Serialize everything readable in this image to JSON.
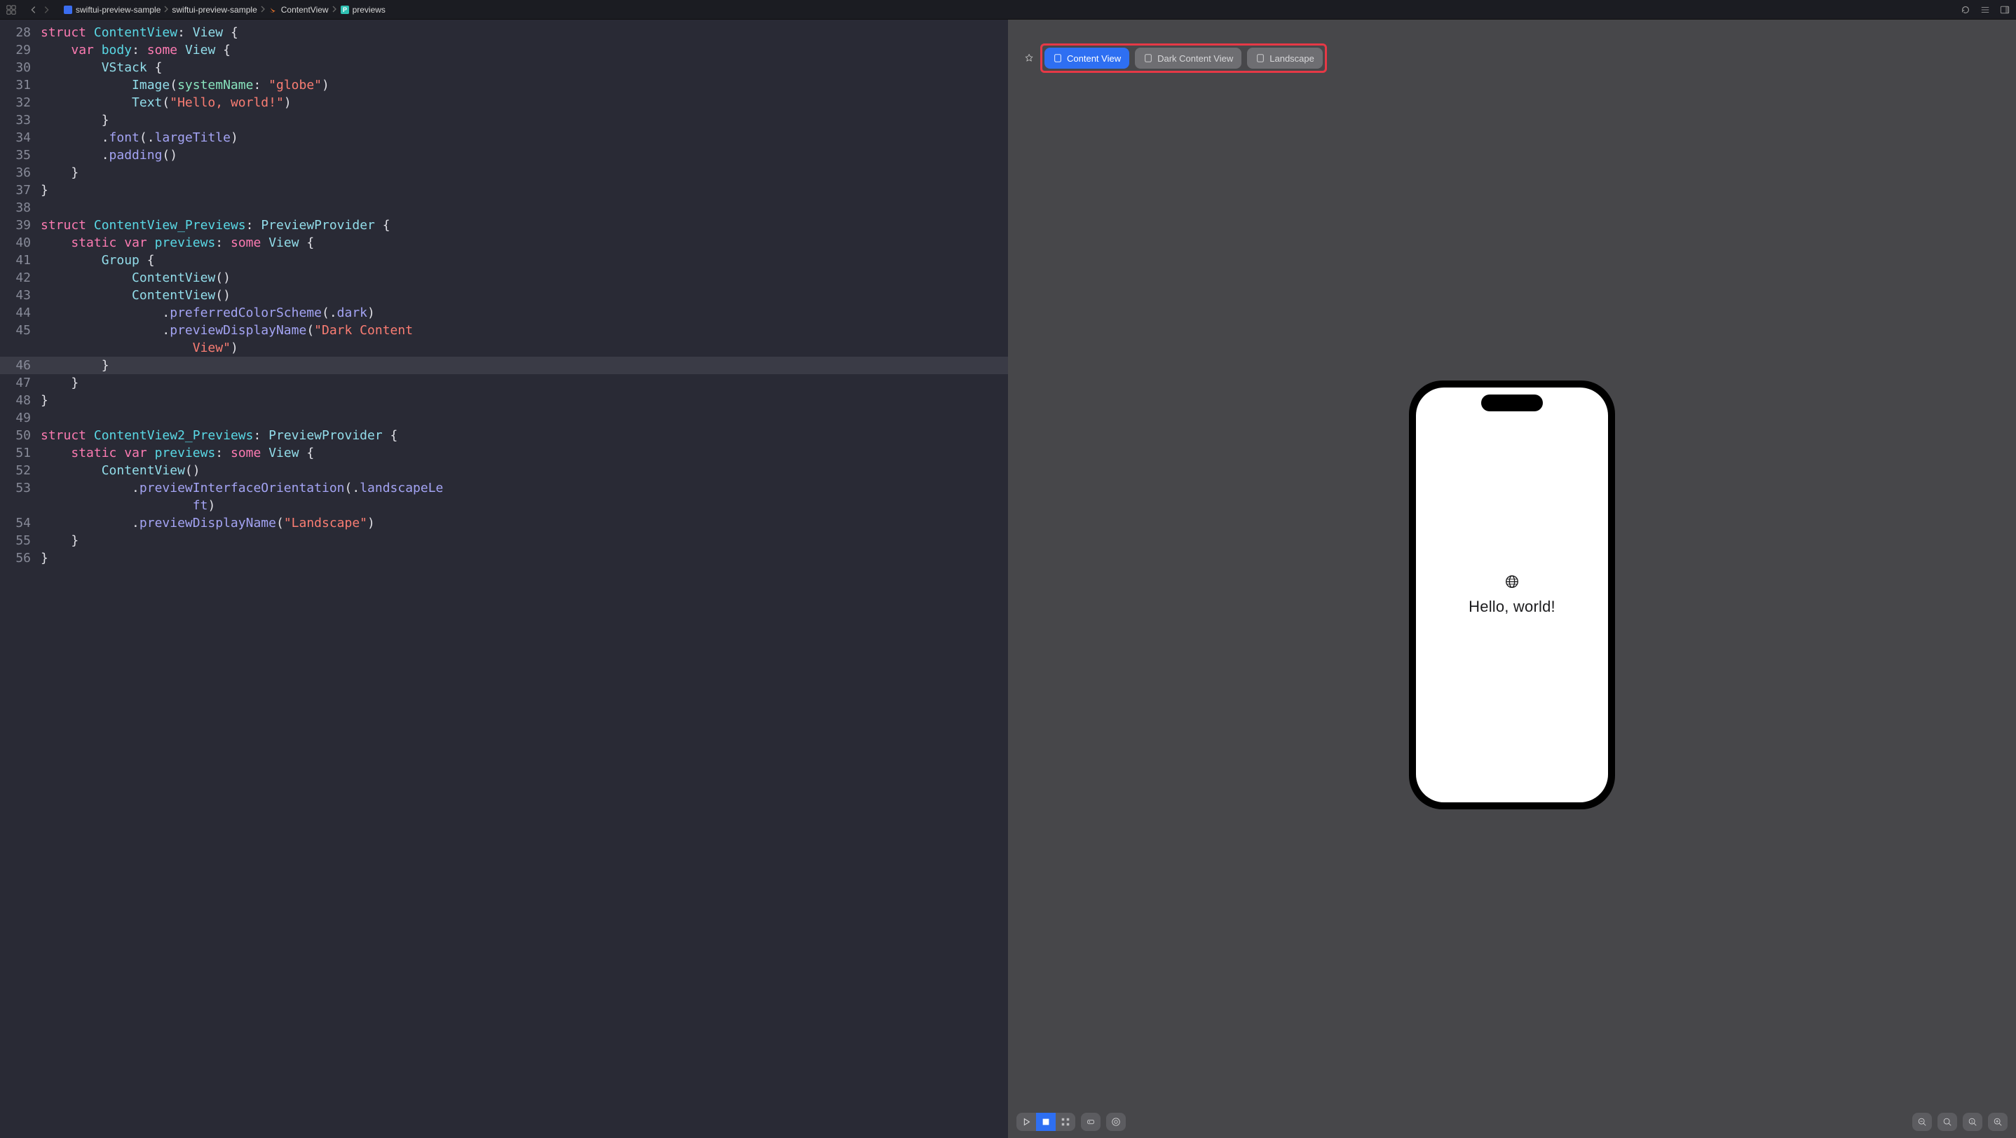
{
  "breadcrumb": {
    "items": [
      {
        "label": "swiftui-preview-sample",
        "icon": "proj"
      },
      {
        "label": "swiftui-preview-sample",
        "icon": "none"
      },
      {
        "label": "ContentView",
        "icon": "swift"
      },
      {
        "label": "previews",
        "icon": "p"
      }
    ]
  },
  "editor": {
    "startLine": 28,
    "cursorLine": 46,
    "lines": [
      [
        [
          "kw",
          "struct"
        ],
        [
          "plain",
          " "
        ],
        [
          "typeDecl",
          "ContentView"
        ],
        [
          "plain",
          ": "
        ],
        [
          "type",
          "View"
        ],
        [
          "plain",
          " {"
        ]
      ],
      [
        [
          "plain",
          "    "
        ],
        [
          "kw",
          "var"
        ],
        [
          "plain",
          " "
        ],
        [
          "typeDecl",
          "body"
        ],
        [
          "plain",
          ": "
        ],
        [
          "kw",
          "some"
        ],
        [
          "plain",
          " "
        ],
        [
          "type",
          "View"
        ],
        [
          "plain",
          " {"
        ]
      ],
      [
        [
          "plain",
          "        "
        ],
        [
          "type",
          "VStack"
        ],
        [
          "plain",
          " {"
        ]
      ],
      [
        [
          "plain",
          "            "
        ],
        [
          "type",
          "Image"
        ],
        [
          "plain",
          "("
        ],
        [
          "param",
          "systemName"
        ],
        [
          "plain",
          ": "
        ],
        [
          "string",
          "\"globe\""
        ],
        [
          "plain",
          ")"
        ]
      ],
      [
        [
          "plain",
          "            "
        ],
        [
          "type",
          "Text"
        ],
        [
          "plain",
          "("
        ],
        [
          "string",
          "\"Hello, world!\""
        ],
        [
          "plain",
          ")"
        ]
      ],
      [
        [
          "plain",
          "        }"
        ]
      ],
      [
        [
          "plain",
          "        ."
        ],
        [
          "func",
          "font"
        ],
        [
          "plain",
          "(."
        ],
        [
          "member",
          "largeTitle"
        ],
        [
          "plain",
          ")"
        ]
      ],
      [
        [
          "plain",
          "        ."
        ],
        [
          "func",
          "padding"
        ],
        [
          "plain",
          "()"
        ]
      ],
      [
        [
          "plain",
          "    }"
        ]
      ],
      [
        [
          "plain",
          "}"
        ]
      ],
      [
        [
          "plain",
          ""
        ]
      ],
      [
        [
          "kw",
          "struct"
        ],
        [
          "plain",
          " "
        ],
        [
          "typeDecl",
          "ContentView_Previews"
        ],
        [
          "plain",
          ": "
        ],
        [
          "type",
          "PreviewProvider"
        ],
        [
          "plain",
          " {"
        ]
      ],
      [
        [
          "plain",
          "    "
        ],
        [
          "kw",
          "static"
        ],
        [
          "plain",
          " "
        ],
        [
          "kw",
          "var"
        ],
        [
          "plain",
          " "
        ],
        [
          "typeDecl",
          "previews"
        ],
        [
          "plain",
          ": "
        ],
        [
          "kw",
          "some"
        ],
        [
          "plain",
          " "
        ],
        [
          "type",
          "View"
        ],
        [
          "plain",
          " {"
        ]
      ],
      [
        [
          "plain",
          "        "
        ],
        [
          "type",
          "Group"
        ],
        [
          "plain",
          " {"
        ]
      ],
      [
        [
          "plain",
          "            "
        ],
        [
          "type",
          "ContentView"
        ],
        [
          "plain",
          "()"
        ]
      ],
      [
        [
          "plain",
          "            "
        ],
        [
          "type",
          "ContentView"
        ],
        [
          "plain",
          "()"
        ]
      ],
      [
        [
          "plain",
          "                ."
        ],
        [
          "func",
          "preferredColorScheme"
        ],
        [
          "plain",
          "(."
        ],
        [
          "member",
          "dark"
        ],
        [
          "plain",
          ")"
        ]
      ],
      [
        [
          "plain",
          "                ."
        ],
        [
          "func",
          "previewDisplayName"
        ],
        [
          "plain",
          "("
        ],
        [
          "string",
          "\"Dark Content View\""
        ],
        [
          "plain",
          ")"
        ]
      ],
      [
        [
          "plain",
          "        }"
        ]
      ],
      [
        [
          "plain",
          "    }"
        ]
      ],
      [
        [
          "plain",
          "}"
        ]
      ],
      [
        [
          "plain",
          ""
        ]
      ],
      [
        [
          "kw",
          "struct"
        ],
        [
          "plain",
          " "
        ],
        [
          "typeDecl",
          "ContentView2_Previews"
        ],
        [
          "plain",
          ": "
        ],
        [
          "type",
          "PreviewProvider"
        ],
        [
          "plain",
          " {"
        ]
      ],
      [
        [
          "plain",
          "    "
        ],
        [
          "kw",
          "static"
        ],
        [
          "plain",
          " "
        ],
        [
          "kw",
          "var"
        ],
        [
          "plain",
          " "
        ],
        [
          "typeDecl",
          "previews"
        ],
        [
          "plain",
          ": "
        ],
        [
          "kw",
          "some"
        ],
        [
          "plain",
          " "
        ],
        [
          "type",
          "View"
        ],
        [
          "plain",
          " {"
        ]
      ],
      [
        [
          "plain",
          "        "
        ],
        [
          "type",
          "ContentView"
        ],
        [
          "plain",
          "()"
        ]
      ],
      [
        [
          "plain",
          "            ."
        ],
        [
          "func",
          "previewInterfaceOrientation"
        ],
        [
          "plain",
          "(."
        ],
        [
          "member",
          "landscapeLeft"
        ],
        [
          "plain",
          ")"
        ]
      ],
      [
        [
          "plain",
          "            ."
        ],
        [
          "func",
          "previewDisplayName"
        ],
        [
          "plain",
          "("
        ],
        [
          "string",
          "\"Landscape\""
        ],
        [
          "plain",
          ")"
        ]
      ],
      [
        [
          "plain",
          "    }"
        ]
      ],
      [
        [
          "plain",
          "}"
        ]
      ]
    ],
    "wrapIndent": "                    "
  },
  "preview": {
    "tabs": [
      {
        "label": "Content View",
        "active": true
      },
      {
        "label": "Dark Content View",
        "active": false
      },
      {
        "label": "Landscape",
        "active": false
      }
    ],
    "app": {
      "icon": "globe",
      "text": "Hello, world!"
    }
  }
}
